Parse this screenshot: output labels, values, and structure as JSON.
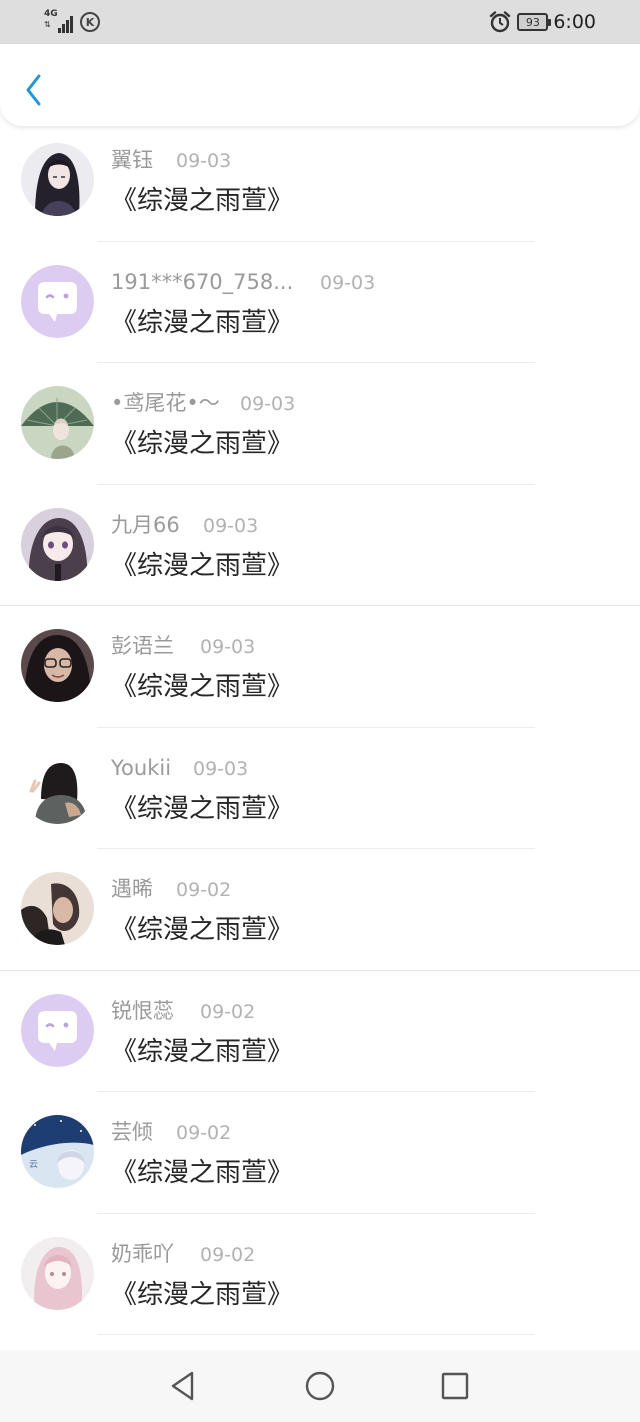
{
  "status_bar": {
    "network": "4G",
    "battery_level": "93",
    "time": "6:00",
    "icons": [
      "signal-icon",
      "k-app-icon",
      "alarm-icon",
      "battery-icon"
    ]
  },
  "header": {
    "back_icon": "chevron-left-icon",
    "accent_color": "#2196d6"
  },
  "items": [
    {
      "name": "翼钰",
      "date": "09-03",
      "title": "《综漫之雨萱》",
      "avatar": "anime-avatar"
    },
    {
      "name": "191***670_758...",
      "date": "09-03",
      "title": "《综漫之雨萱》",
      "avatar": "default-chat-avatar"
    },
    {
      "name": "•鸢尾花•～",
      "date": "09-03",
      "title": "《综漫之雨萱》",
      "avatar": "umbrella-avatar"
    },
    {
      "name": "九月66",
      "date": "09-03",
      "title": "《综漫之雨萱》",
      "avatar": "anime-girl-avatar"
    },
    {
      "name": "彭语兰",
      "date": "09-03",
      "title": "《综漫之雨萱》",
      "avatar": "photo-avatar"
    },
    {
      "name": "Youkii",
      "date": "09-03",
      "title": "《综漫之雨萱》",
      "avatar": "figure-avatar"
    },
    {
      "name": "遇晞",
      "date": "09-02",
      "title": "《综漫之雨萱》",
      "avatar": "photo-avatar"
    },
    {
      "name": "锐恨蕊",
      "date": "09-02",
      "title": "《综漫之雨萱》",
      "avatar": "default-chat-avatar"
    },
    {
      "name": "芸倾",
      "date": "09-02",
      "title": "《综漫之雨萱》",
      "avatar": "night-sky-avatar"
    },
    {
      "name": "奶乖吖",
      "date": "09-02",
      "title": "《综漫之雨萱》",
      "avatar": "pink-hair-avatar"
    }
  ],
  "nav_bar": {
    "back_icon": "triangle-back-icon",
    "home_icon": "circle-home-icon",
    "recents_icon": "square-recents-icon"
  }
}
